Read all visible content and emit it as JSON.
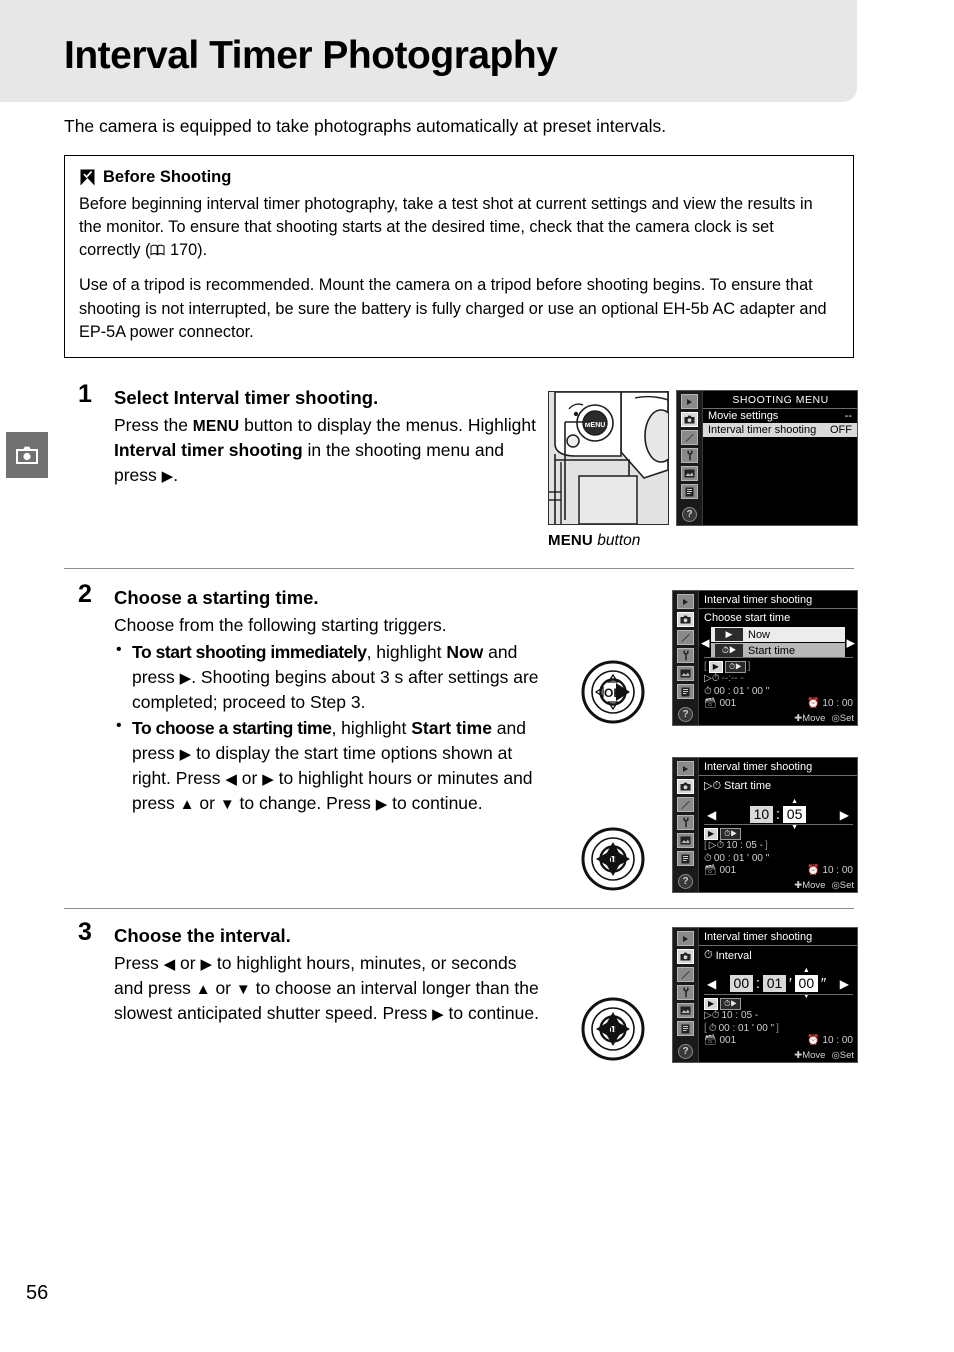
{
  "page": {
    "title": "Interval Timer Photography",
    "number": "56",
    "intro": "The camera is equipped to take photographs automatically at preset intervals."
  },
  "side_tab": {
    "icon": "camera-icon"
  },
  "caution": {
    "title": "Before Shooting",
    "icon": "caution-checkmark-icon",
    "paragraph1_a": "Before beginning interval timer photography, take a test shot at current settings and view the results in the monitor. To ensure that shooting starts at the desired time, check that the camera clock is set correctly (",
    "paragraph1_ref": "170",
    "paragraph1_b": ").",
    "paragraph2": "Use of a tripod is recommended.  Mount the camera on a tripod before shooting begins.  To ensure that shooting is not interrupted, be sure the battery is fully charged or use an optional EH-5b AC adapter and EP-5A power connector."
  },
  "steps": [
    {
      "number": "1",
      "heading_a": "Select ",
      "heading_b": "Interval timer shooting.",
      "text_a": "Press the ",
      "menu_word": "MENU",
      "text_b": " button to display the menus. Highlight ",
      "bold_b": "Interval timer shooting",
      "text_c": " in the shooting menu and press ",
      "text_d": "."
    },
    {
      "number": "2",
      "heading": "Choose a starting time.",
      "text": "Choose from the following starting triggers.",
      "bullets": [
        {
          "cond": "To start shooting immediately",
          "mid": ", highlight ",
          "option": "Now",
          "rest_a": " and press ",
          "rest_b": ".  Shooting begins about 3 s after settings are completed; proceed to Step 3."
        },
        {
          "cond": "To choose a starting time",
          "mid": ", highlight ",
          "option": "Start time",
          "rest_a": " and press ",
          "rest_b": " to display the start time options shown at right. Press ",
          "rest_c": " or ",
          "rest_d": " to highlight hours or minutes and press ",
          "rest_e": " or ",
          "rest_f": " to change.  Press ",
          "rest_g": " to continue."
        }
      ]
    },
    {
      "number": "3",
      "heading": "Choose the interval.",
      "text_a": "Press ",
      "text_b": " or ",
      "text_c": " to highlight hours, minutes, or seconds and press ",
      "text_d": " or ",
      "text_e": " to choose an interval longer than the slowest anticipated shutter speed.  Press ",
      "text_f": " to continue."
    }
  ],
  "camera_figure": {
    "caption_button": "MENU",
    "caption_word": "button",
    "button_label": "MENU"
  },
  "lcd_screens": {
    "shooting_menu": {
      "title": "SHOOTING MENU",
      "rows": [
        {
          "label": "Movie settings",
          "value": "--",
          "selected": false
        },
        {
          "label": "Interval timer shooting",
          "value": "OFF",
          "selected": true
        }
      ],
      "help_icon": "question-icon"
    },
    "choose_start_time": {
      "title": "Interval timer shooting",
      "subtitle": "Choose start time",
      "options": [
        {
          "label": "Now",
          "icon": "play-icon",
          "highlighted": true
        },
        {
          "label": "Start time",
          "icon": "clock-play-icon",
          "highlighted": false
        }
      ],
      "status": {
        "mode_badges": [
          "play-icon",
          "clock-play-icon"
        ],
        "start_time": "--:-- -",
        "interval": "00 : 01 ' 00 \"",
        "shots": "001",
        "clock": "10 : 00"
      },
      "footer_move": "Move",
      "footer_set": "Set"
    },
    "start_time": {
      "title": "Interval timer shooting",
      "subtitle": "Start time",
      "hours": "10",
      "separator": ":",
      "minutes": "05",
      "active_field": "minutes",
      "status": {
        "start_time": "10 : 05  -",
        "interval": "00 : 01 ' 00 \"",
        "shots": "001",
        "clock": "10 : 00"
      },
      "footer_move": "Move",
      "footer_set": "Set"
    },
    "interval": {
      "title": "Interval timer shooting",
      "subtitle": "Interval",
      "hours": "00",
      "minutes": "01",
      "seconds": "00",
      "active_field": "seconds",
      "status": {
        "start_time": "10 : 05  -",
        "interval": "00 : 01 ' 00 \"",
        "shots": "001",
        "clock": "10 : 00"
      },
      "footer_move": "Move",
      "footer_set": "Set"
    }
  },
  "colors": {
    "header_band": "#e7e7e7",
    "side_tab": "#717171",
    "rule": "#8d8d8d",
    "lcd_bg": "#000000",
    "lcd_highlight": "#ececec"
  }
}
